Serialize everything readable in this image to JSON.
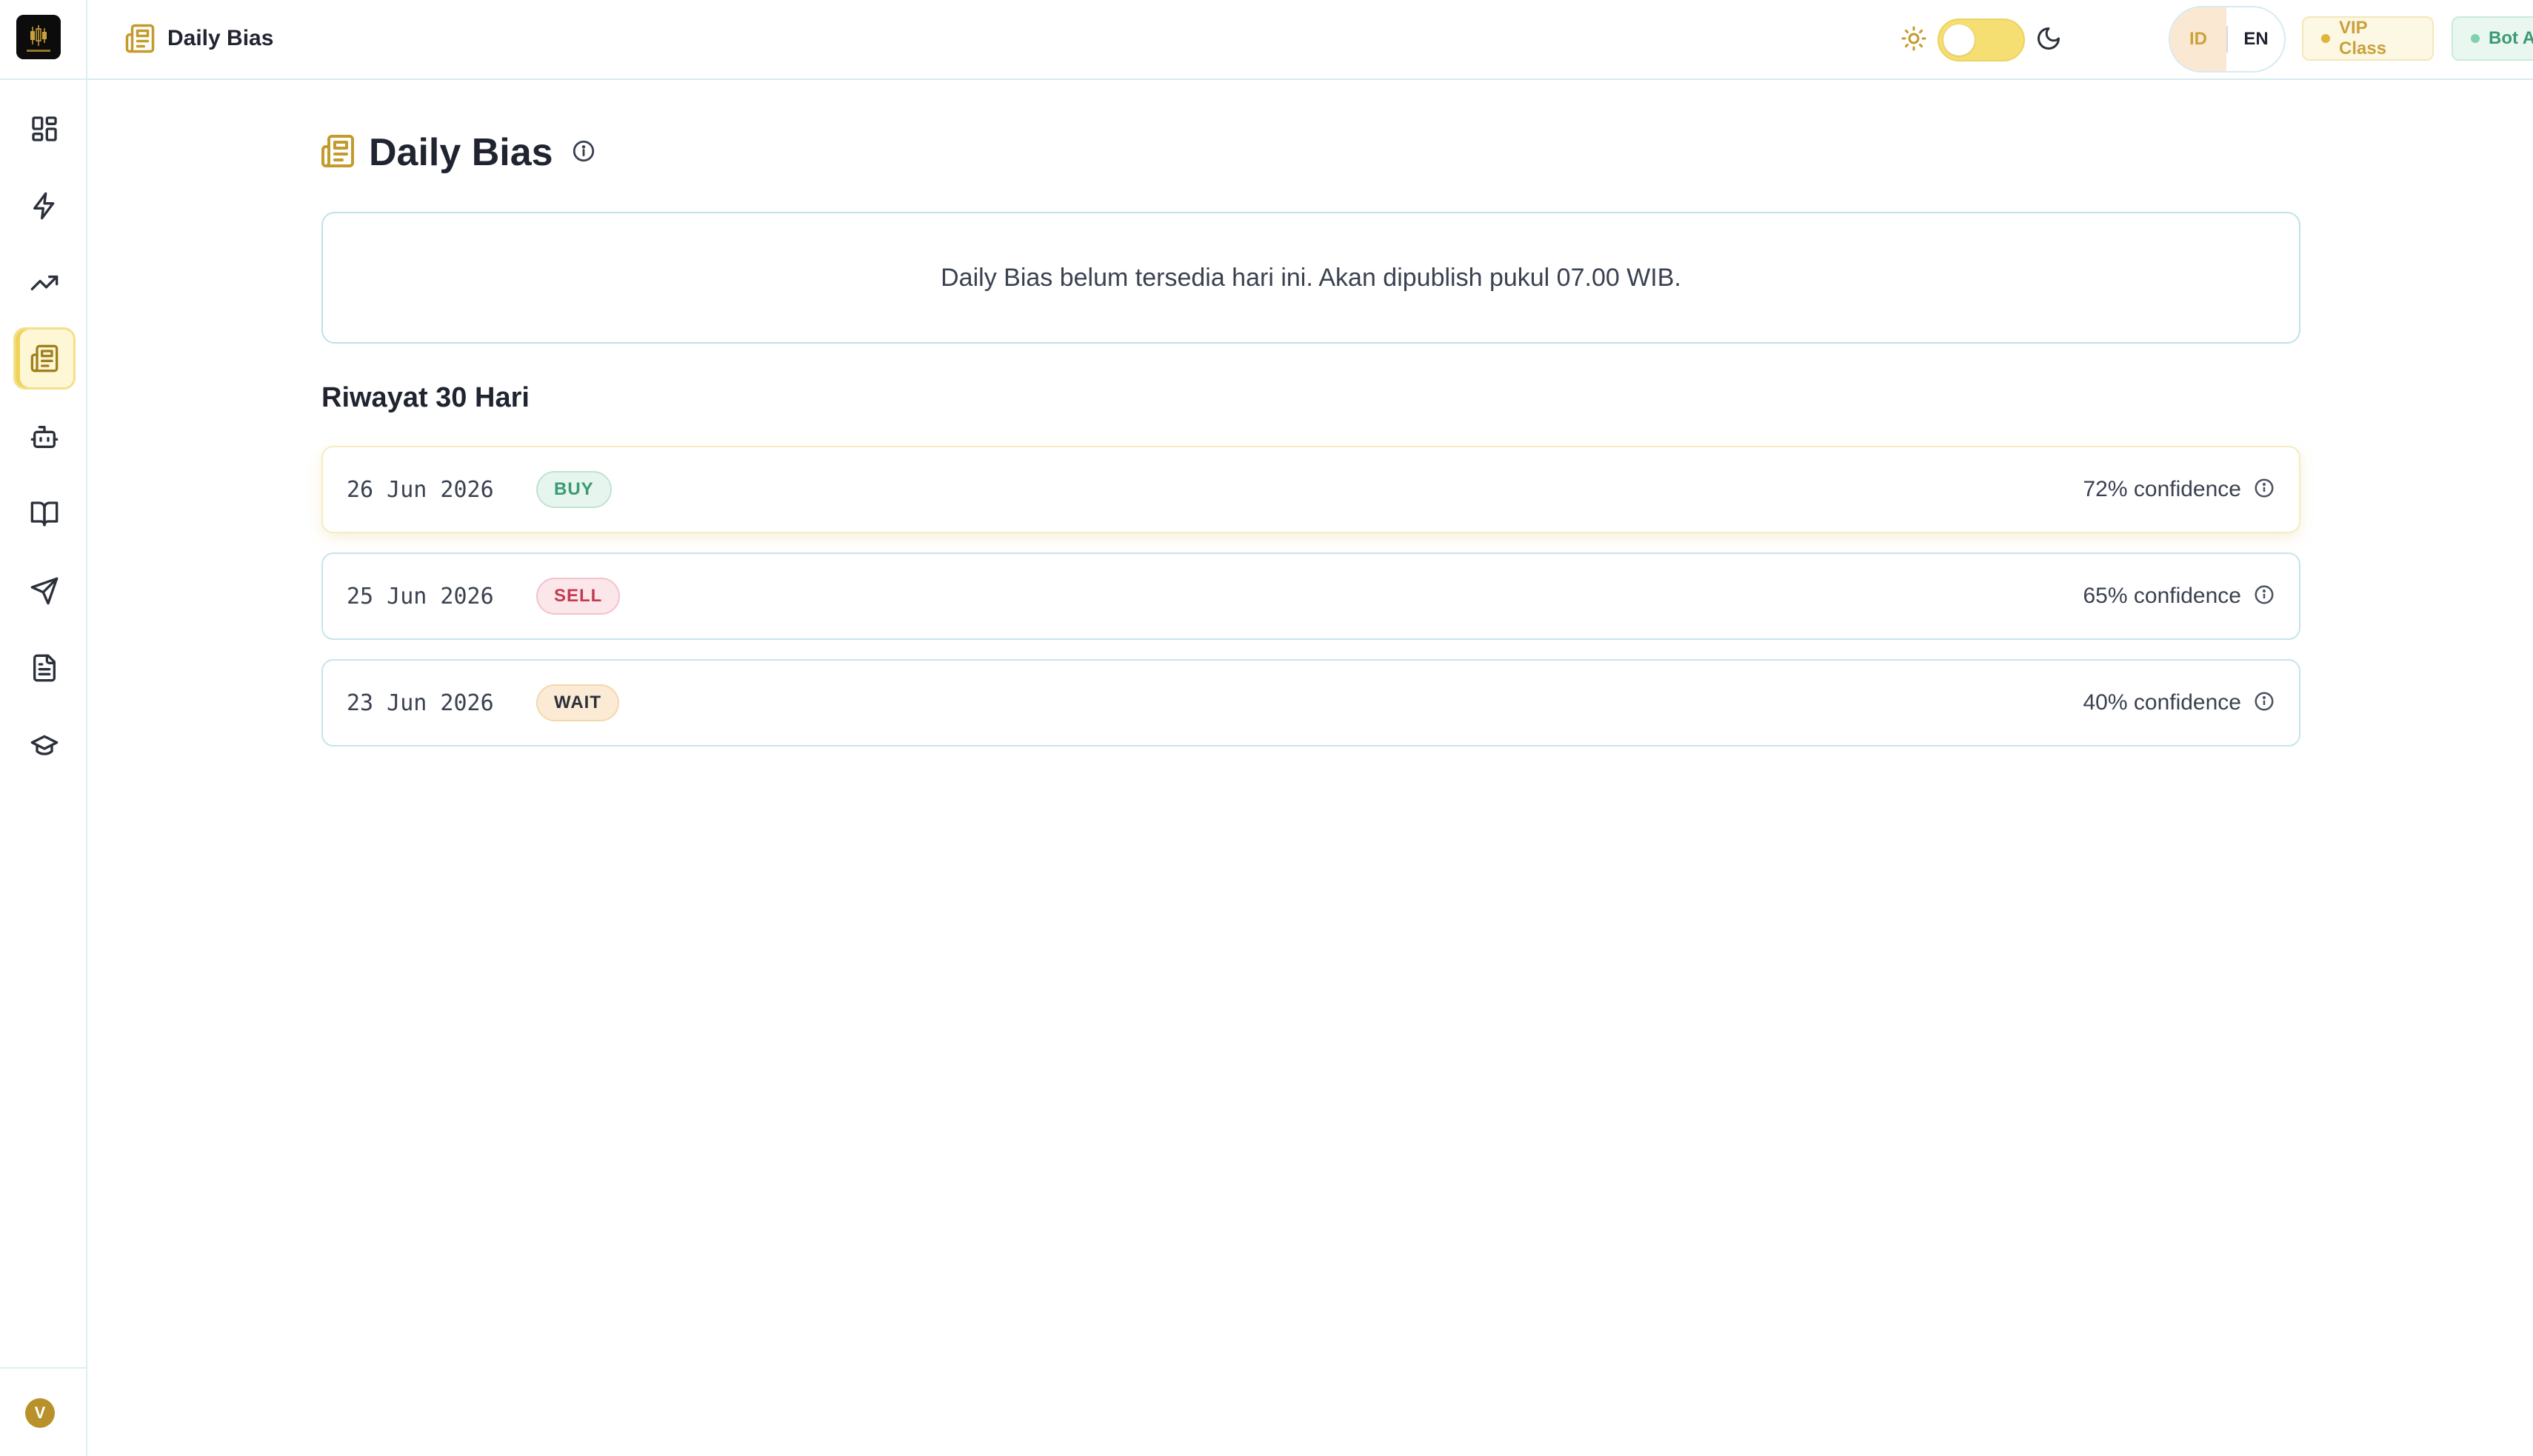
{
  "header": {
    "title": "Daily Bias",
    "title_icon": "newspaper-icon"
  },
  "theme": {
    "light_icon": "sun-icon",
    "dark_icon": "moon-icon",
    "mode": "light"
  },
  "language": {
    "options": [
      "ID",
      "EN"
    ],
    "selected": "ID"
  },
  "badges": {
    "vip_label": "VIP Class",
    "bot_label": "Bot Aktif"
  },
  "sidebar": {
    "items": [
      {
        "icon": "dashboard-icon"
      },
      {
        "icon": "lightning-icon"
      },
      {
        "icon": "trending-up-icon"
      },
      {
        "icon": "newspaper-icon",
        "active": true
      },
      {
        "icon": "bot-icon"
      },
      {
        "icon": "book-open-icon"
      },
      {
        "icon": "send-icon"
      },
      {
        "icon": "file-text-icon"
      },
      {
        "icon": "graduation-cap-icon"
      }
    ],
    "avatar_initial": "V"
  },
  "main": {
    "title": "Daily Bias",
    "notice": "Daily Bias belum tersedia hari ini. Akan dipublish pukul 07.00 WIB.",
    "history_heading": "Riwayat 30 Hari",
    "history": [
      {
        "date": "26 Jun 2026",
        "signal": "BUY",
        "confidence": "72% confidence"
      },
      {
        "date": "25 Jun 2026",
        "signal": "SELL",
        "confidence": "65% confidence"
      },
      {
        "date": "23 Jun 2026",
        "signal": "WAIT",
        "confidence": "40% confidence"
      }
    ]
  },
  "colors": {
    "accent_gold": "#c49a2c",
    "buy_green": "#3a9a74",
    "sell_red": "#c23b50",
    "border_teal": "#c6e4ea"
  }
}
